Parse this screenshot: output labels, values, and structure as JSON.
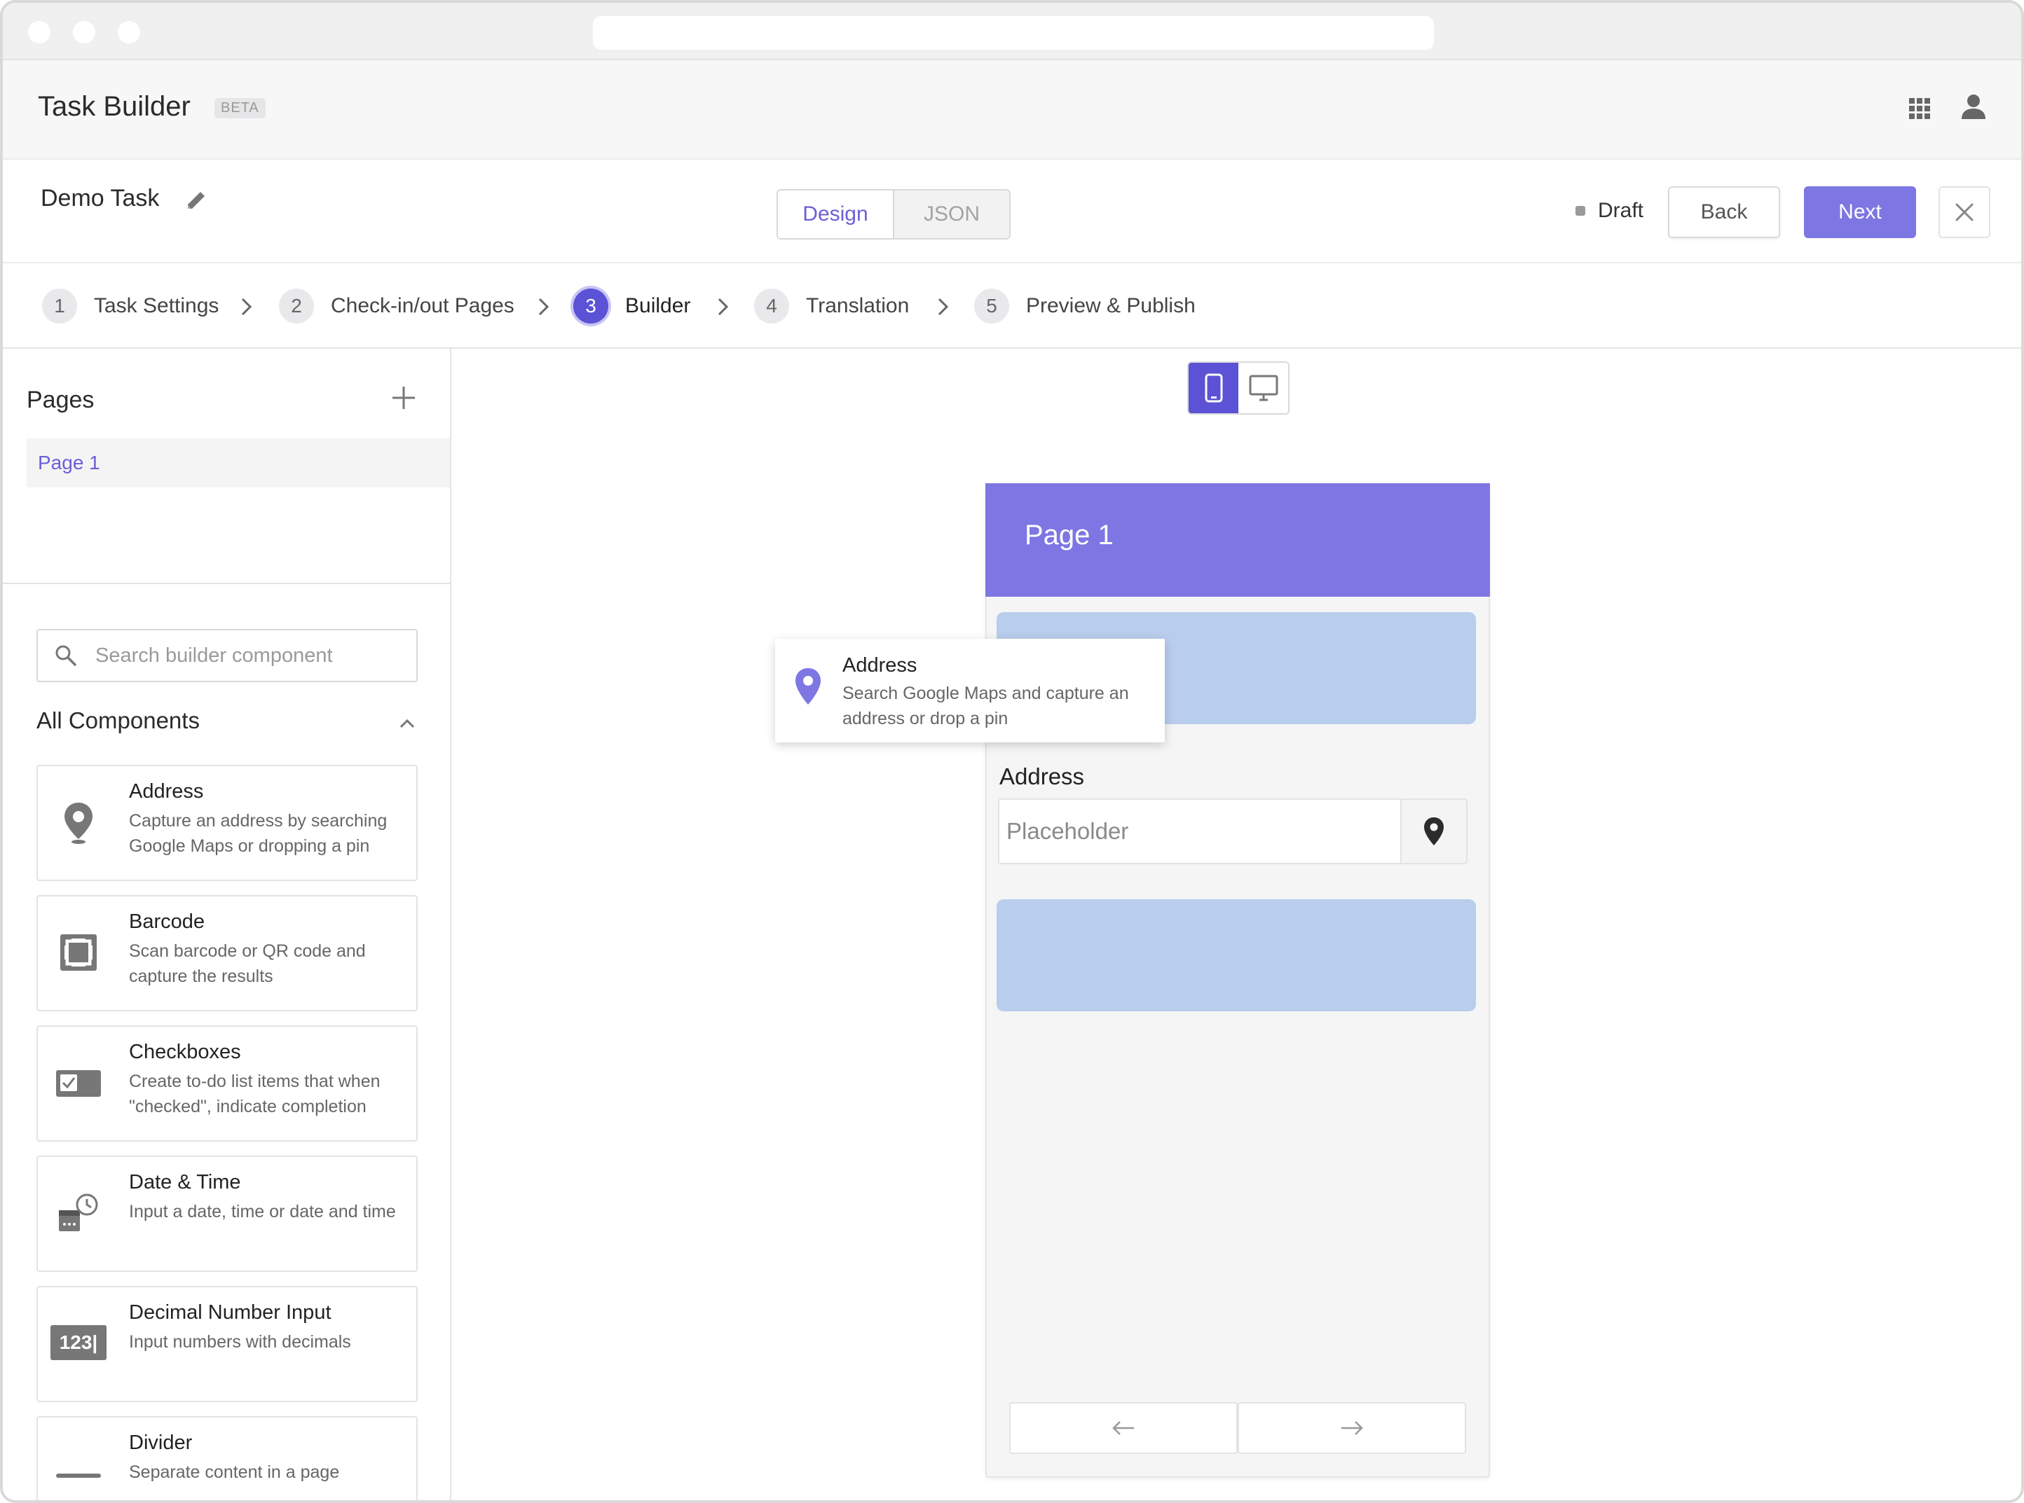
{
  "app": {
    "title": "Task Builder",
    "badge": "BETA",
    "icons": {
      "apps": "grid-icon",
      "account": "user-icon"
    }
  },
  "task": {
    "name": "Demo Task",
    "view_tabs": [
      "Design",
      "JSON"
    ],
    "active_view": "Design",
    "status": "Draft",
    "back_label": "Back",
    "next_label": "Next"
  },
  "steps": [
    {
      "num": "1",
      "label": "Task Settings"
    },
    {
      "num": "2",
      "label": "Check-in/out Pages"
    },
    {
      "num": "3",
      "label": "Builder",
      "active": true
    },
    {
      "num": "4",
      "label": "Translation"
    },
    {
      "num": "5",
      "label": "Preview & Publish"
    }
  ],
  "sidebar": {
    "pages_title": "Pages",
    "pages": [
      "Page 1"
    ],
    "search_placeholder": "Search builder component",
    "components_title": "All Components",
    "components": [
      {
        "name": "Address",
        "desc": "Capture an address by searching Google Maps or dropping a pin",
        "icon": "map-pin-icon"
      },
      {
        "name": "Barcode",
        "desc": "Scan barcode or QR code and capture the results",
        "icon": "barcode-scan-icon"
      },
      {
        "name": "Checkboxes",
        "desc": "Create to-do list items that when \"checked\", indicate completion",
        "icon": "checkbox-icon"
      },
      {
        "name": "Date & Time",
        "desc": "Input a date, time or date and time",
        "icon": "calendar-clock-icon"
      },
      {
        "name": "Decimal Number Input",
        "desc": "Input numbers with decimals",
        "icon": "number-input-icon",
        "icon_text": "123|"
      },
      {
        "name": "Divider",
        "desc": "Separate content in a page",
        "icon": "divider-icon"
      }
    ]
  },
  "canvas": {
    "device_modes": [
      "mobile",
      "desktop"
    ],
    "active_device": "mobile",
    "page_title": "Page 1",
    "field_label": "Address",
    "field_placeholder": "Placeholder",
    "dragging": {
      "name": "Address",
      "desc": "Search Google Maps and capture an address or drop a pin"
    }
  },
  "colors": {
    "accent": "#7d76e3",
    "accent_dark": "#5b52d6",
    "drop_zone": "#b9cdec"
  }
}
